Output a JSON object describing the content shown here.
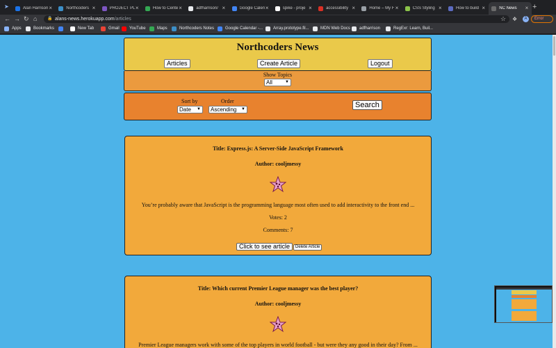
{
  "browser": {
    "tabs": [
      {
        "title": "Alan Harrison",
        "color": "#1a73e8"
      },
      {
        "title": "Northcoders",
        "color": "#3c8fc8"
      },
      {
        "title": "PROJECT PLAN",
        "color": "#7e57c2"
      },
      {
        "title": "How to Center",
        "color": "#34a853"
      },
      {
        "title": "adfharrison/",
        "color": "#e8eaed"
      },
      {
        "title": "Google Calendar",
        "color": "#4285f4"
      },
      {
        "title": "spike - proje",
        "color": "#ffffff"
      },
      {
        "title": "accessibility",
        "color": "#d93025"
      },
      {
        "title": "Home – My Fi",
        "color": "#9aa0a6"
      },
      {
        "title": "CSS Styling",
        "color": "#8bc34a"
      },
      {
        "title": "How to build",
        "color": "#5c6bc0"
      },
      {
        "title": "NC News",
        "color": "#6b6b6b"
      }
    ],
    "active_tab": 11,
    "url_host": "alans-news.herokuapp.com",
    "url_path": "/articles",
    "error_label": "Error",
    "profile_initial": "A",
    "bookmarks": [
      {
        "label": "Apps",
        "color": "#8ab4f8"
      },
      {
        "label": "Bookmarks",
        "color": "#e8eaed"
      },
      {
        "label": "",
        "color": "#4285f4"
      },
      {
        "label": "New Tab",
        "color": "#ffffff"
      },
      {
        "label": "Gmail",
        "color": "#ea4335"
      },
      {
        "label": "YouTube",
        "color": "#ff0000"
      },
      {
        "label": "Maps",
        "color": "#34a853"
      },
      {
        "label": "Northcoders Notes",
        "color": "#3c8fc8"
      },
      {
        "label": "Google Calendar -...",
        "color": "#4285f4"
      },
      {
        "label": "Array.prototype.fil...",
        "color": "#e8eaed"
      },
      {
        "label": "MDN Web Docs",
        "color": "#e8eaed"
      },
      {
        "label": "adfharrison",
        "color": "#e8eaed"
      },
      {
        "label": "RegExr: Learn, Buil...",
        "color": "#e8eaed"
      }
    ]
  },
  "page": {
    "site_title": "Northcoders News",
    "nav": {
      "articles": "Articles",
      "create_article": "Create Article",
      "logout": "Logout"
    },
    "topics": {
      "label": "Show Topics",
      "selected": "All"
    },
    "sort": {
      "sort_by_label": "Sort by",
      "sort_by_value": "Date",
      "order_label": "Order",
      "order_value": "Ascending",
      "search_label": "Search"
    },
    "articles": [
      {
        "title": "Title: Express.js: A Server-Side JavaScript Framework",
        "author": "Author: cooljmessy",
        "body": "You’re probably aware that JavaScript is the programming language most often used to add interactivity to the front end ...",
        "votes": "Votes: 2",
        "comments": "Comments: 7",
        "view_label": "Click to see article",
        "delete_label": "Delete Article"
      },
      {
        "title": "Title: Which current Premier League manager was the best player?",
        "author": "Author: cooljmessy",
        "body": "Premier League managers work with some of the top players in world football - but were they any good in their day? From ..."
      }
    ],
    "colors": {
      "background": "#4db3e8",
      "header": "#eac94a",
      "topics_bar": "#eb9a3e",
      "sort_bar": "#e8822e",
      "card": "#f2a93b"
    }
  }
}
